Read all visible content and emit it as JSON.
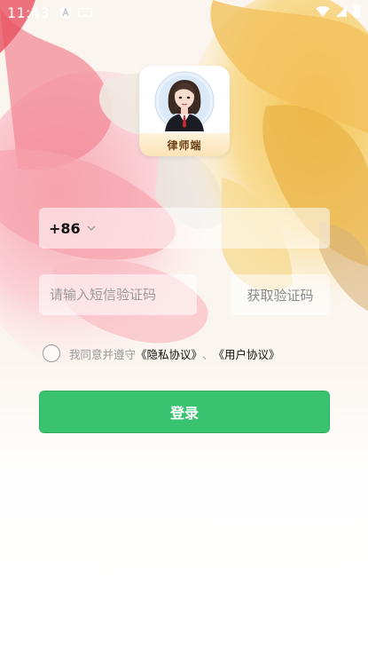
{
  "status_bar": {
    "time": "11:43",
    "left_icons": [
      "a-badge-icon",
      "keyboard-icon"
    ],
    "right_icons": [
      "wifi-icon",
      "signal-icon",
      "battery-icon"
    ]
  },
  "logo": {
    "label": "律师端",
    "avatar_icon": "lawyer-avatar-icon"
  },
  "phone": {
    "country_code": "+86",
    "value": "",
    "placeholder": ""
  },
  "verification": {
    "placeholder": "请输入短信验证码",
    "value": "",
    "get_code_label": "获取验证码"
  },
  "agreement": {
    "prefix": "我同意并遵守",
    "privacy_link": "《隐私协议》",
    "separator": "、",
    "user_link": "《用户协议》",
    "checked": false
  },
  "login": {
    "label": "登录",
    "color": "#39c26f"
  }
}
